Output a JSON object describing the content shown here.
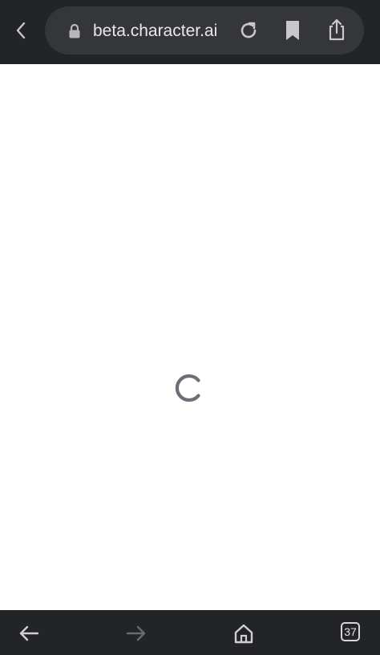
{
  "browser": {
    "url_text": "beta.character.ai",
    "tab_count": "37"
  },
  "icons": {
    "back": "chevron-left-icon",
    "lock": "lock-icon",
    "reload": "reload-icon",
    "bookmark": "bookmark-icon",
    "share": "share-icon",
    "nav_back": "arrow-left-icon",
    "nav_forward": "arrow-right-icon",
    "home": "home-icon",
    "tabs": "tabs-icon",
    "loading": "spinner-icon"
  },
  "colors": {
    "bar_background": "#232427",
    "pill_background": "#35363a",
    "spinner": "#6b6f76",
    "page_background": "#ffffff"
  }
}
